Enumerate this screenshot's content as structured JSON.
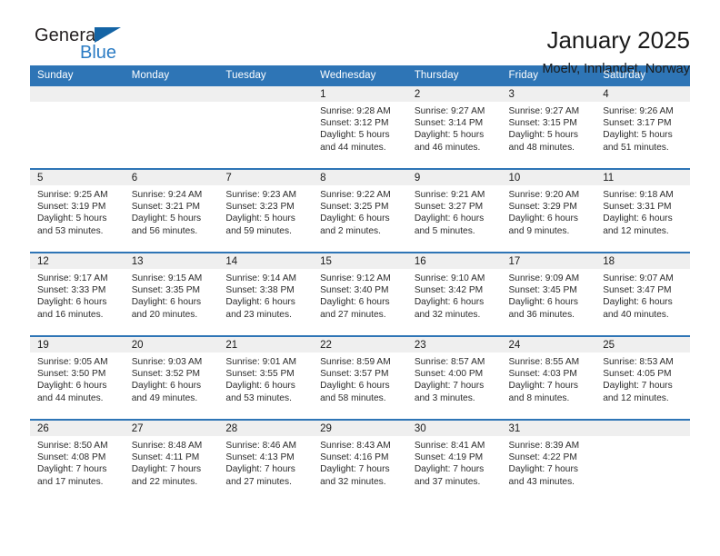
{
  "brand": {
    "name_part1": "General",
    "name_part2": "Blue",
    "flag_icon": "triangle-flag-icon"
  },
  "header": {
    "title": "January 2025",
    "subtitle": "Moelv, Innlandet, Norway"
  },
  "colors": {
    "header_blue": "#2e75b6",
    "logo_blue": "#2b7cc4",
    "day_band_gray": "#efefef",
    "text": "#1a1a1a"
  },
  "weekday_headers": [
    "Sunday",
    "Monday",
    "Tuesday",
    "Wednesday",
    "Thursday",
    "Friday",
    "Saturday"
  ],
  "labels": {
    "sunrise_prefix": "Sunrise:",
    "sunset_prefix": "Sunset:",
    "daylight_prefix": "Daylight:"
  },
  "weeks": [
    [
      {
        "day": "",
        "empty": true
      },
      {
        "day": "",
        "empty": true
      },
      {
        "day": "",
        "empty": true
      },
      {
        "day": "1",
        "sunrise": "Sunrise: 9:28 AM",
        "sunset": "Sunset: 3:12 PM",
        "daylight_line1": "Daylight: 5 hours",
        "daylight_line2": "and 44 minutes."
      },
      {
        "day": "2",
        "sunrise": "Sunrise: 9:27 AM",
        "sunset": "Sunset: 3:14 PM",
        "daylight_line1": "Daylight: 5 hours",
        "daylight_line2": "and 46 minutes."
      },
      {
        "day": "3",
        "sunrise": "Sunrise: 9:27 AM",
        "sunset": "Sunset: 3:15 PM",
        "daylight_line1": "Daylight: 5 hours",
        "daylight_line2": "and 48 minutes."
      },
      {
        "day": "4",
        "sunrise": "Sunrise: 9:26 AM",
        "sunset": "Sunset: 3:17 PM",
        "daylight_line1": "Daylight: 5 hours",
        "daylight_line2": "and 51 minutes."
      }
    ],
    [
      {
        "day": "5",
        "sunrise": "Sunrise: 9:25 AM",
        "sunset": "Sunset: 3:19 PM",
        "daylight_line1": "Daylight: 5 hours",
        "daylight_line2": "and 53 minutes."
      },
      {
        "day": "6",
        "sunrise": "Sunrise: 9:24 AM",
        "sunset": "Sunset: 3:21 PM",
        "daylight_line1": "Daylight: 5 hours",
        "daylight_line2": "and 56 minutes."
      },
      {
        "day": "7",
        "sunrise": "Sunrise: 9:23 AM",
        "sunset": "Sunset: 3:23 PM",
        "daylight_line1": "Daylight: 5 hours",
        "daylight_line2": "and 59 minutes."
      },
      {
        "day": "8",
        "sunrise": "Sunrise: 9:22 AM",
        "sunset": "Sunset: 3:25 PM",
        "daylight_line1": "Daylight: 6 hours",
        "daylight_line2": "and 2 minutes."
      },
      {
        "day": "9",
        "sunrise": "Sunrise: 9:21 AM",
        "sunset": "Sunset: 3:27 PM",
        "daylight_line1": "Daylight: 6 hours",
        "daylight_line2": "and 5 minutes."
      },
      {
        "day": "10",
        "sunrise": "Sunrise: 9:20 AM",
        "sunset": "Sunset: 3:29 PM",
        "daylight_line1": "Daylight: 6 hours",
        "daylight_line2": "and 9 minutes."
      },
      {
        "day": "11",
        "sunrise": "Sunrise: 9:18 AM",
        "sunset": "Sunset: 3:31 PM",
        "daylight_line1": "Daylight: 6 hours",
        "daylight_line2": "and 12 minutes."
      }
    ],
    [
      {
        "day": "12",
        "sunrise": "Sunrise: 9:17 AM",
        "sunset": "Sunset: 3:33 PM",
        "daylight_line1": "Daylight: 6 hours",
        "daylight_line2": "and 16 minutes."
      },
      {
        "day": "13",
        "sunrise": "Sunrise: 9:15 AM",
        "sunset": "Sunset: 3:35 PM",
        "daylight_line1": "Daylight: 6 hours",
        "daylight_line2": "and 20 minutes."
      },
      {
        "day": "14",
        "sunrise": "Sunrise: 9:14 AM",
        "sunset": "Sunset: 3:38 PM",
        "daylight_line1": "Daylight: 6 hours",
        "daylight_line2": "and 23 minutes."
      },
      {
        "day": "15",
        "sunrise": "Sunrise: 9:12 AM",
        "sunset": "Sunset: 3:40 PM",
        "daylight_line1": "Daylight: 6 hours",
        "daylight_line2": "and 27 minutes."
      },
      {
        "day": "16",
        "sunrise": "Sunrise: 9:10 AM",
        "sunset": "Sunset: 3:42 PM",
        "daylight_line1": "Daylight: 6 hours",
        "daylight_line2": "and 32 minutes."
      },
      {
        "day": "17",
        "sunrise": "Sunrise: 9:09 AM",
        "sunset": "Sunset: 3:45 PM",
        "daylight_line1": "Daylight: 6 hours",
        "daylight_line2": "and 36 minutes."
      },
      {
        "day": "18",
        "sunrise": "Sunrise: 9:07 AM",
        "sunset": "Sunset: 3:47 PM",
        "daylight_line1": "Daylight: 6 hours",
        "daylight_line2": "and 40 minutes."
      }
    ],
    [
      {
        "day": "19",
        "sunrise": "Sunrise: 9:05 AM",
        "sunset": "Sunset: 3:50 PM",
        "daylight_line1": "Daylight: 6 hours",
        "daylight_line2": "and 44 minutes."
      },
      {
        "day": "20",
        "sunrise": "Sunrise: 9:03 AM",
        "sunset": "Sunset: 3:52 PM",
        "daylight_line1": "Daylight: 6 hours",
        "daylight_line2": "and 49 minutes."
      },
      {
        "day": "21",
        "sunrise": "Sunrise: 9:01 AM",
        "sunset": "Sunset: 3:55 PM",
        "daylight_line1": "Daylight: 6 hours",
        "daylight_line2": "and 53 minutes."
      },
      {
        "day": "22",
        "sunrise": "Sunrise: 8:59 AM",
        "sunset": "Sunset: 3:57 PM",
        "daylight_line1": "Daylight: 6 hours",
        "daylight_line2": "and 58 minutes."
      },
      {
        "day": "23",
        "sunrise": "Sunrise: 8:57 AM",
        "sunset": "Sunset: 4:00 PM",
        "daylight_line1": "Daylight: 7 hours",
        "daylight_line2": "and 3 minutes."
      },
      {
        "day": "24",
        "sunrise": "Sunrise: 8:55 AM",
        "sunset": "Sunset: 4:03 PM",
        "daylight_line1": "Daylight: 7 hours",
        "daylight_line2": "and 8 minutes."
      },
      {
        "day": "25",
        "sunrise": "Sunrise: 8:53 AM",
        "sunset": "Sunset: 4:05 PM",
        "daylight_line1": "Daylight: 7 hours",
        "daylight_line2": "and 12 minutes."
      }
    ],
    [
      {
        "day": "26",
        "sunrise": "Sunrise: 8:50 AM",
        "sunset": "Sunset: 4:08 PM",
        "daylight_line1": "Daylight: 7 hours",
        "daylight_line2": "and 17 minutes."
      },
      {
        "day": "27",
        "sunrise": "Sunrise: 8:48 AM",
        "sunset": "Sunset: 4:11 PM",
        "daylight_line1": "Daylight: 7 hours",
        "daylight_line2": "and 22 minutes."
      },
      {
        "day": "28",
        "sunrise": "Sunrise: 8:46 AM",
        "sunset": "Sunset: 4:13 PM",
        "daylight_line1": "Daylight: 7 hours",
        "daylight_line2": "and 27 minutes."
      },
      {
        "day": "29",
        "sunrise": "Sunrise: 8:43 AM",
        "sunset": "Sunset: 4:16 PM",
        "daylight_line1": "Daylight: 7 hours",
        "daylight_line2": "and 32 minutes."
      },
      {
        "day": "30",
        "sunrise": "Sunrise: 8:41 AM",
        "sunset": "Sunset: 4:19 PM",
        "daylight_line1": "Daylight: 7 hours",
        "daylight_line2": "and 37 minutes."
      },
      {
        "day": "31",
        "sunrise": "Sunrise: 8:39 AM",
        "sunset": "Sunset: 4:22 PM",
        "daylight_line1": "Daylight: 7 hours",
        "daylight_line2": "and 43 minutes."
      },
      {
        "day": "",
        "empty": true
      }
    ]
  ]
}
